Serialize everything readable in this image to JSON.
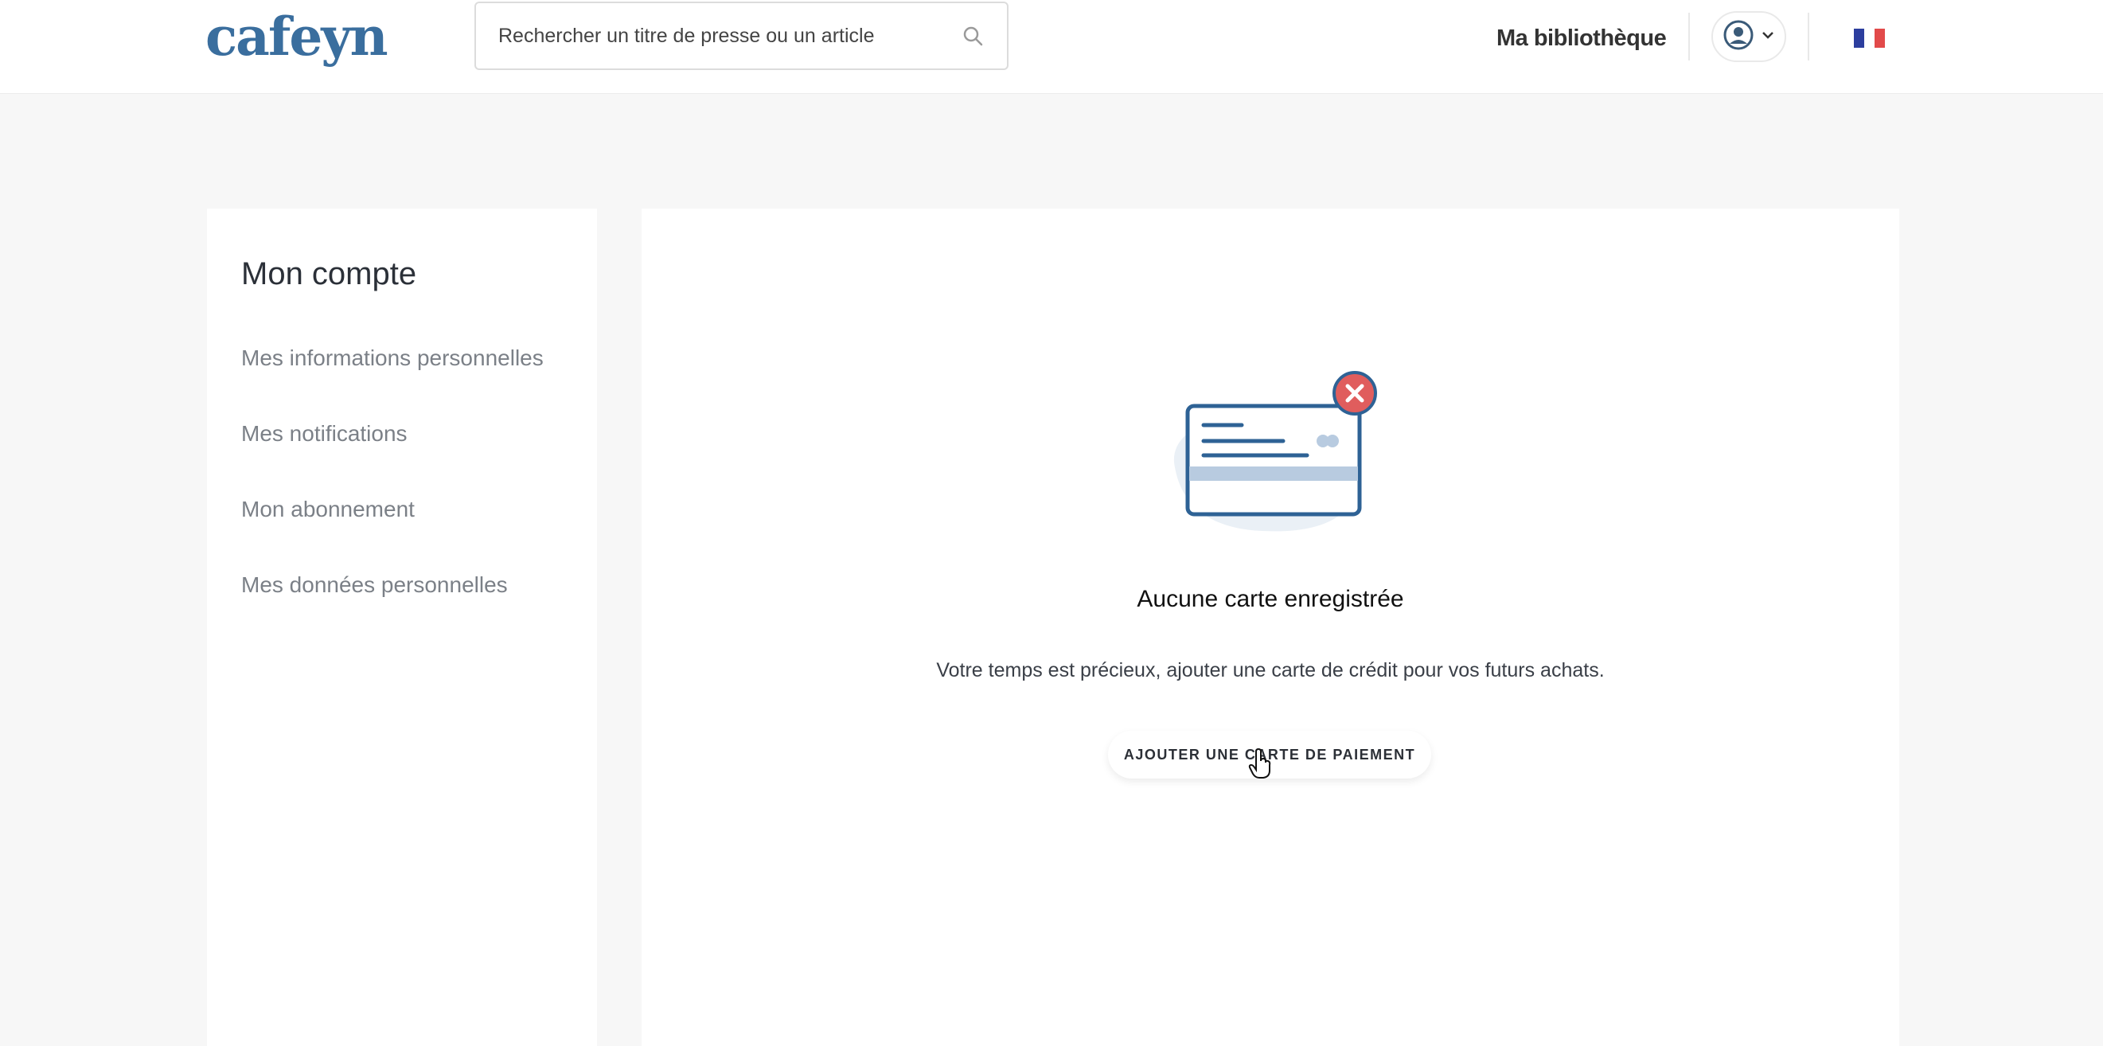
{
  "header": {
    "logo_text": "cafeyn",
    "search": {
      "placeholder": "Rechercher un titre de presse ou un article",
      "icon": "search-icon"
    },
    "library_link": "Ma bibliothèque",
    "user_menu": {
      "icon": "user-circle-icon",
      "chevron": "chevron-down-icon"
    },
    "language_flag": {
      "icon": "france-flag-icon",
      "colors": [
        "#2c3e9e",
        "#ffffff",
        "#e24a4a"
      ]
    }
  },
  "sidebar": {
    "title": "Mon compte",
    "items": [
      {
        "label": "Mes informations personnelles"
      },
      {
        "label": "Mes notifications"
      },
      {
        "label": "Mon abonnement"
      },
      {
        "label": "Mes données personnelles"
      }
    ]
  },
  "main": {
    "illustration": "credit-card-error-icon",
    "empty_title": "Aucune carte enregistrée",
    "empty_text": "Votre temps est précieux, ajouter une carte de crédit pour vos futurs achats.",
    "add_card_button": "AJOUTER UNE CARTE DE PAIEMENT"
  },
  "colors": {
    "brand": "#3a6e9e",
    "page_bg": "#f7f7f7",
    "error": "#e05d5d"
  }
}
